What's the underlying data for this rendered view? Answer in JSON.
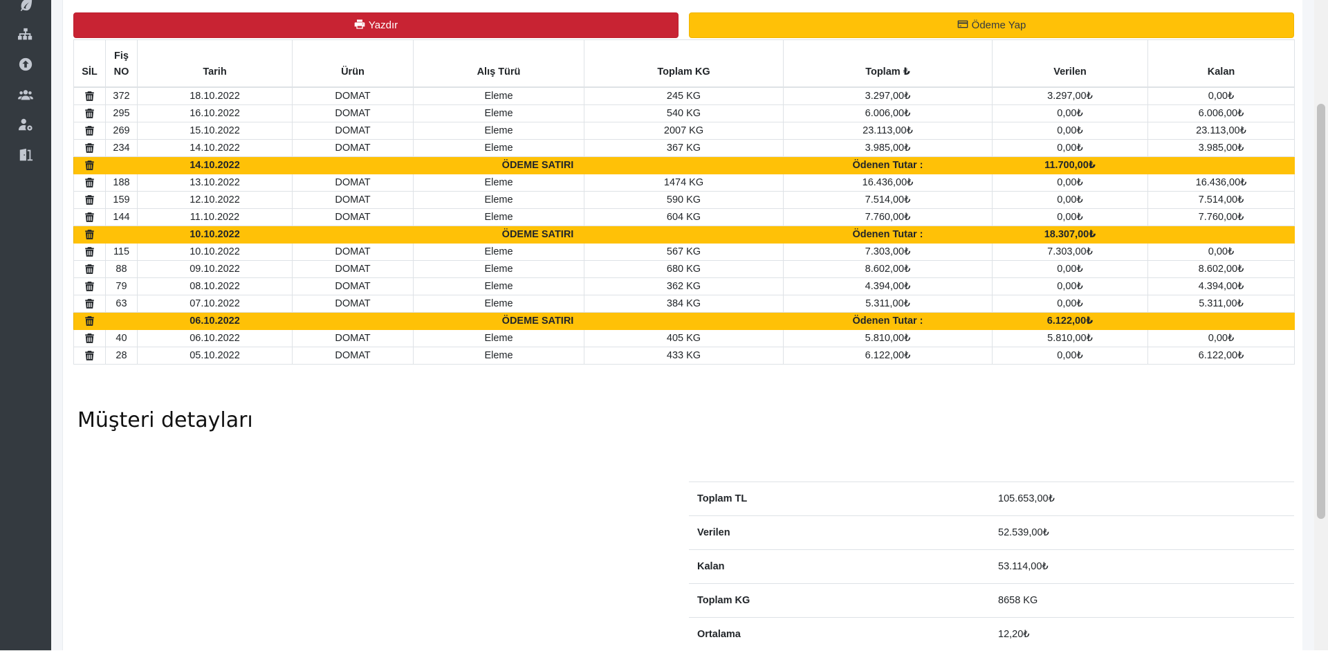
{
  "actions": {
    "print_label": "Yazdır",
    "pay_label": "Ödeme Yap"
  },
  "table": {
    "headers": {
      "delete": "SİL",
      "receipt_line1": "Fiş",
      "receipt_line2": "NO",
      "date": "Tarih",
      "product": "Ürün",
      "purchase_type": "Alış Türü",
      "total_kg": "Toplam KG",
      "total_tl": "Toplam ₺",
      "paid": "Verilen",
      "remaining": "Kalan"
    },
    "rows": [
      {
        "type": "data",
        "no": "372",
        "date": "18.10.2022",
        "product": "DOMAT",
        "kind": "Eleme",
        "kg": "245 KG",
        "total": "3.297,00₺",
        "paid": "3.297,00₺",
        "remaining": "0,00₺"
      },
      {
        "type": "data",
        "no": "295",
        "date": "16.10.2022",
        "product": "DOMAT",
        "kind": "Eleme",
        "kg": "540 KG",
        "total": "6.006,00₺",
        "paid": "0,00₺",
        "remaining": "6.006,00₺"
      },
      {
        "type": "data",
        "no": "269",
        "date": "15.10.2022",
        "product": "DOMAT",
        "kind": "Eleme",
        "kg": "2007 KG",
        "total": "23.113,00₺",
        "paid": "0,00₺",
        "remaining": "23.113,00₺"
      },
      {
        "type": "data",
        "no": "234",
        "date": "14.10.2022",
        "product": "DOMAT",
        "kind": "Eleme",
        "kg": "367 KG",
        "total": "3.985,00₺",
        "paid": "0,00₺",
        "remaining": "3.985,00₺"
      },
      {
        "type": "payment",
        "date": "14.10.2022",
        "label": "ÖDEME SATIRI",
        "paid_label": "Ödenen Tutar :",
        "amount": "11.700,00₺"
      },
      {
        "type": "data",
        "no": "188",
        "date": "13.10.2022",
        "product": "DOMAT",
        "kind": "Eleme",
        "kg": "1474 KG",
        "total": "16.436,00₺",
        "paid": "0,00₺",
        "remaining": "16.436,00₺"
      },
      {
        "type": "data",
        "no": "159",
        "date": "12.10.2022",
        "product": "DOMAT",
        "kind": "Eleme",
        "kg": "590 KG",
        "total": "7.514,00₺",
        "paid": "0,00₺",
        "remaining": "7.514,00₺"
      },
      {
        "type": "data",
        "no": "144",
        "date": "11.10.2022",
        "product": "DOMAT",
        "kind": "Eleme",
        "kg": "604 KG",
        "total": "7.760,00₺",
        "paid": "0,00₺",
        "remaining": "7.760,00₺"
      },
      {
        "type": "payment",
        "date": "10.10.2022",
        "label": "ÖDEME SATIRI",
        "paid_label": "Ödenen Tutar :",
        "amount": "18.307,00₺"
      },
      {
        "type": "data",
        "no": "115",
        "date": "10.10.2022",
        "product": "DOMAT",
        "kind": "Eleme",
        "kg": "567 KG",
        "total": "7.303,00₺",
        "paid": "7.303,00₺",
        "remaining": "0,00₺"
      },
      {
        "type": "data",
        "no": "88",
        "date": "09.10.2022",
        "product": "DOMAT",
        "kind": "Eleme",
        "kg": "680 KG",
        "total": "8.602,00₺",
        "paid": "0,00₺",
        "remaining": "8.602,00₺"
      },
      {
        "type": "data",
        "no": "79",
        "date": "08.10.2022",
        "product": "DOMAT",
        "kind": "Eleme",
        "kg": "362 KG",
        "total": "4.394,00₺",
        "paid": "0,00₺",
        "remaining": "4.394,00₺"
      },
      {
        "type": "data",
        "no": "63",
        "date": "07.10.2022",
        "product": "DOMAT",
        "kind": "Eleme",
        "kg": "384 KG",
        "total": "5.311,00₺",
        "paid": "0,00₺",
        "remaining": "5.311,00₺"
      },
      {
        "type": "payment",
        "date": "06.10.2022",
        "label": "ÖDEME SATIRI",
        "paid_label": "Ödenen Tutar :",
        "amount": "6.122,00₺"
      },
      {
        "type": "data",
        "no": "40",
        "date": "06.10.2022",
        "product": "DOMAT",
        "kind": "Eleme",
        "kg": "405 KG",
        "total": "5.810,00₺",
        "paid": "5.810,00₺",
        "remaining": "0,00₺"
      },
      {
        "type": "data",
        "no": "28",
        "date": "05.10.2022",
        "product": "DOMAT",
        "kind": "Eleme",
        "kg": "433 KG",
        "total": "6.122,00₺",
        "paid": "0,00₺",
        "remaining": "6.122,00₺"
      }
    ]
  },
  "details": {
    "title": "Müşteri detayları",
    "items": [
      {
        "label": "Toplam TL",
        "value": "105.653,00₺"
      },
      {
        "label": "Verilen",
        "value": "52.539,00₺"
      },
      {
        "label": "Kalan",
        "value": "53.114,00₺"
      },
      {
        "label": "Toplam KG",
        "value": "8658 KG"
      },
      {
        "label": "Ortalama",
        "value": "12,20₺"
      }
    ]
  },
  "colors": {
    "print_button": "#c82333",
    "pay_button": "#ffc107",
    "payment_row": "#ffc107",
    "sidebar": "#343a40"
  },
  "icons": {
    "sidebar": [
      "leaf-icon",
      "sitemap-icon",
      "upload-icon",
      "users-icon",
      "user-cog-icon",
      "door-exit-icon"
    ],
    "print": "print-icon",
    "pay": "credit-card-icon",
    "delete": "trash-icon"
  }
}
